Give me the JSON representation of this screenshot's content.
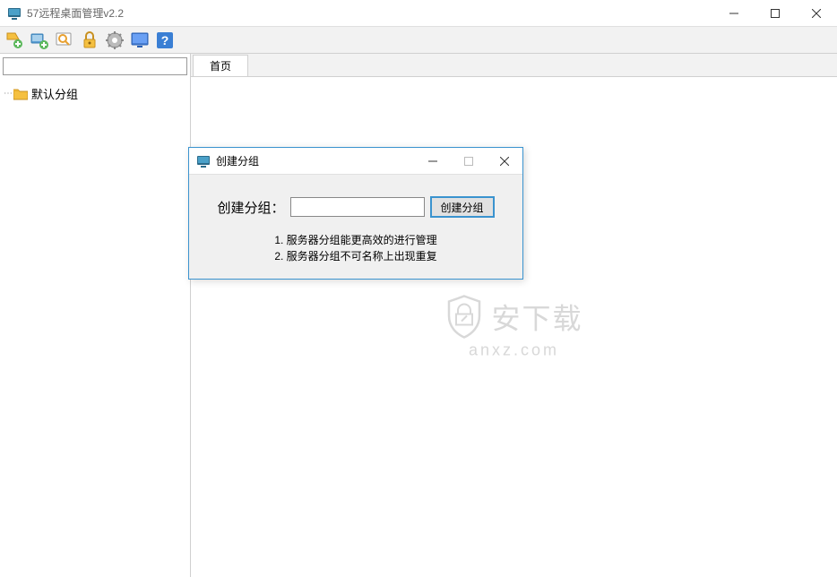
{
  "window": {
    "title": "57远程桌面管理v2.2"
  },
  "toolbar": {
    "icons": [
      "add-host-icon",
      "add-group-icon",
      "search-icon",
      "lock-icon",
      "settings-icon",
      "monitor-icon",
      "help-icon"
    ]
  },
  "sidebar": {
    "default_group": "默认分组"
  },
  "tabs": {
    "home": "首页"
  },
  "watermark": {
    "text": "安下载",
    "sub": "anxz.com"
  },
  "dialog": {
    "title": "创建分组",
    "label": "创建分组：",
    "button": "创建分组",
    "input_value": "",
    "hint1": "1. 服务器分组能更高效的进行管理",
    "hint2": "2. 服务器分组不可名称上出现重复"
  }
}
